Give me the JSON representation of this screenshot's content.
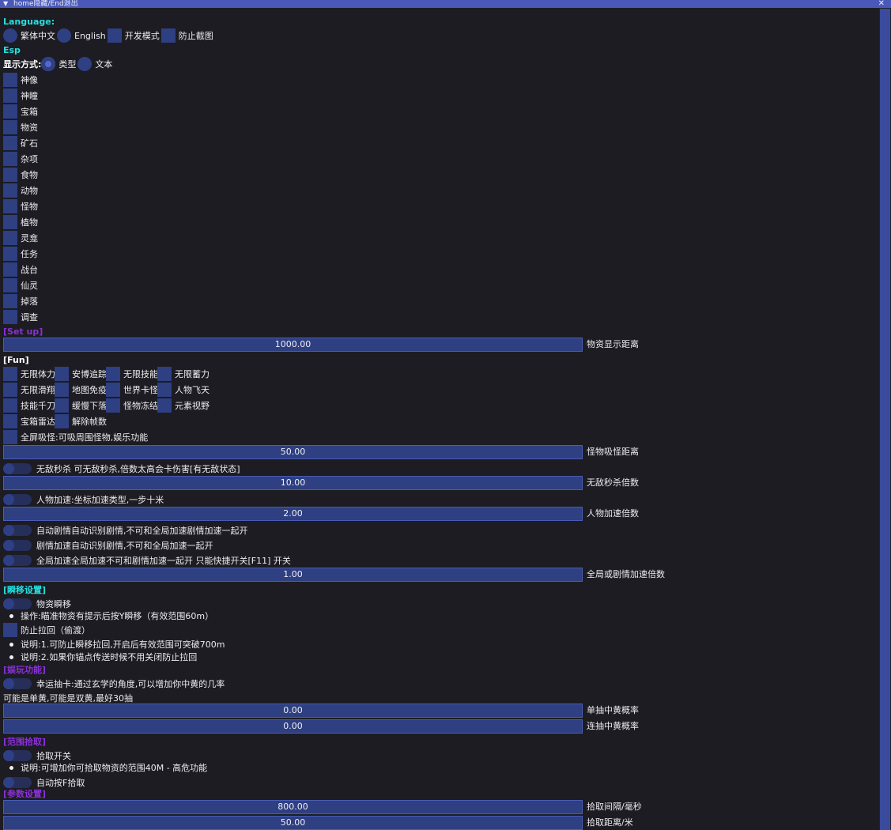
{
  "window": {
    "title": "home隐藏/End退出"
  },
  "language": {
    "heading": "Language:",
    "options": [
      "繁体中文",
      "English"
    ],
    "dev_mode": "开发模式",
    "anti_screenshot": "防止截图"
  },
  "esp": {
    "heading": "Esp",
    "display_mode_label": "显示方式:",
    "display_options": [
      "类型",
      "文本"
    ],
    "items": [
      "神像",
      "神瞳",
      "宝箱",
      "物资",
      "矿石",
      "杂项",
      "食物",
      "动物",
      "怪物",
      "植物",
      "灵龛",
      "任务",
      "战台",
      "仙灵",
      "掉落",
      "调查"
    ]
  },
  "setup": {
    "heading": "[Set up]",
    "distance_value": "1000.00",
    "distance_label": "物资显示距离"
  },
  "fun": {
    "heading": "[Fun]",
    "grid": [
      [
        "无限体力",
        "安博追踪",
        "无限技能",
        "无限蓄力"
      ],
      [
        "无限滑翔",
        "地图免疫",
        "世界卡怪",
        "人物飞天"
      ],
      [
        "技能千刀",
        "缓慢下落",
        "怪物冻结",
        "元素视野"
      ],
      [
        "宝箱雷达",
        "解除帧数"
      ]
    ],
    "fullscreen_pull": "全屏吸怪:可吸周围怪物,娱乐功能",
    "pull_value": "50.00",
    "pull_label": "怪物吸怪距离",
    "godkill_toggle": "无敌秒杀 可无敌秒杀,倍数太高会卡伤害[有无敌状态]",
    "godkill_value": "10.00",
    "godkill_label": "无敌秒杀倍数",
    "speed_toggle": "人物加速:坐标加速类型,一步十米",
    "speed_value": "2.00",
    "speed_label": "人物加速倍数",
    "auto_story": "自动剧情自动识别剧情,不可和全局加速剧情加速一起开",
    "story_speed": "剧情加速自动识别剧情,不可和全局加速一起开",
    "global_speed": "全局加速全局加速不可和剧情加速一起开 只能快捷开关[F11] 开关",
    "global_value": "1.00",
    "global_label": "全局或剧情加速倍数"
  },
  "teleport": {
    "heading": "[瞬移设置]",
    "toggle": "物资瞬移",
    "note1": "操作:瞄准物资有提示后按Y瞬移（有效范围60m）",
    "anti_pullback": "防止拉回（偷渡）",
    "note2": "说明:1.可防止瞬移拉回,开启后有效范围可突破700m",
    "note3": "说明:2.如果你锚点传送时候不用关闭防止拉回"
  },
  "fun2": {
    "heading": "[娱玩功能]",
    "toggle": "幸运抽卡:通过玄学的角度,可以增加你中黄的几率",
    "note": "可能是单黄,可能是双黄,最好30抽",
    "single_value": "0.00",
    "single_label": "单抽中黄概率",
    "multi_value": "0.00",
    "multi_label": "连抽中黄概率"
  },
  "pickup": {
    "heading": "[范围拾取]",
    "toggle": "拾取开关",
    "note": "说明:可增加你可拾取物资的范围40M - 高危功能",
    "auto_f": "自动按F拾取"
  },
  "params": {
    "heading": "[参数设置]",
    "interval_value": "800.00",
    "interval_label": "拾取间隔/毫秒",
    "range_value": "50.00",
    "range_label": "拾取距离/米"
  }
}
